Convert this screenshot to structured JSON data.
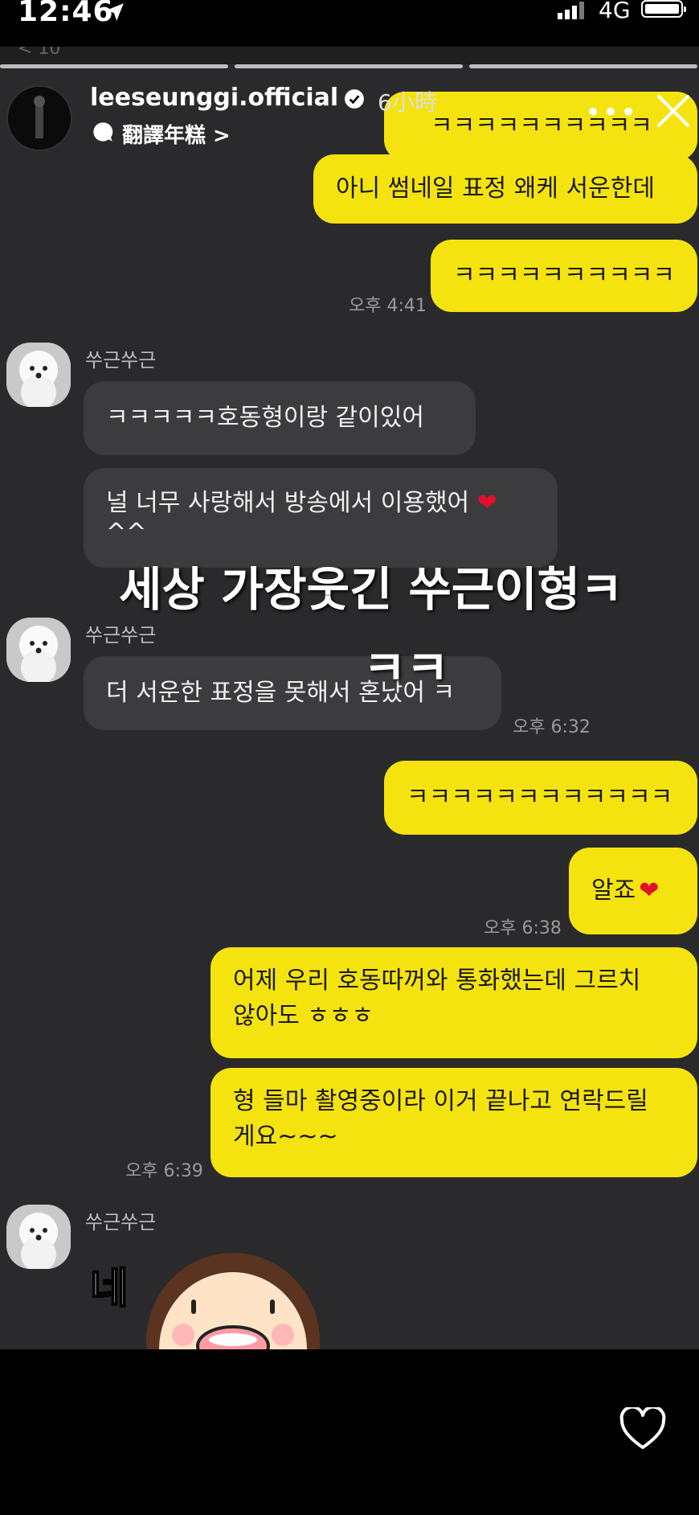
{
  "status_bar": {
    "time": "12:46",
    "network": "4G"
  },
  "story": {
    "username": "leeseunggi.official",
    "time_ago": "6小時",
    "translate_label": "翻譯年糕 >"
  },
  "chat": {
    "messages": [
      {
        "from": "me",
        "text": "ㅋㅋㅋㅋㅋㅋㅋㅋㅋㅋ"
      },
      {
        "from": "me",
        "text": "아니 썸네일 표정 왜케 서운한데"
      },
      {
        "from": "me",
        "text": "ㅋㅋㅋㅋㅋㅋㅋㅋㅋㅋ",
        "time": "오후 4:41"
      },
      {
        "from": "them",
        "sender": "쑤근쑤근",
        "text": "ㅋㅋㅋㅋㅋ호동형이랑 같이있어"
      },
      {
        "from": "them",
        "text": "널 너무 사랑해서 방송에서 이용했어",
        "text2": "^^"
      },
      {
        "from": "them",
        "sender": "쑤근쑤근",
        "text": "더 서운한 표정을 못해서 혼났어 ㅋ",
        "time": "오후 6:32"
      },
      {
        "from": "me",
        "text": "ㅋㅋㅋㅋㅋㅋㅋㅋㅋㅋㅋㅋ"
      },
      {
        "from": "me",
        "text": "알죠",
        "time": "오후 6:38"
      },
      {
        "from": "me",
        "text": "어제 우리 호동따꺼와 통화했는데 그르치",
        "text2": "않아도 ㅎㅎㅎ"
      },
      {
        "from": "me",
        "text": "형 들마 촬영중이라 이거 끝나고 연락드릴",
        "text2": "게요~~~",
        "time": "오후 6:39"
      },
      {
        "from": "them",
        "sender": "쑤근쑤근",
        "sticker_text": "네"
      }
    ],
    "overlay_line1": "세상 가장웃긴 쑤근이형ㅋ",
    "overlay_line2": "ㅋㅋ"
  },
  "colors": {
    "my_bubble": "#f5e30f",
    "their_bubble": "#3c3c3e",
    "chat_bg": "#2a2a2c"
  },
  "icons": [
    "location-arrow-icon",
    "signal-icon",
    "battery-icon",
    "verified-badge-icon",
    "translate-icon",
    "more-icon",
    "close-icon",
    "heart-icon"
  ]
}
